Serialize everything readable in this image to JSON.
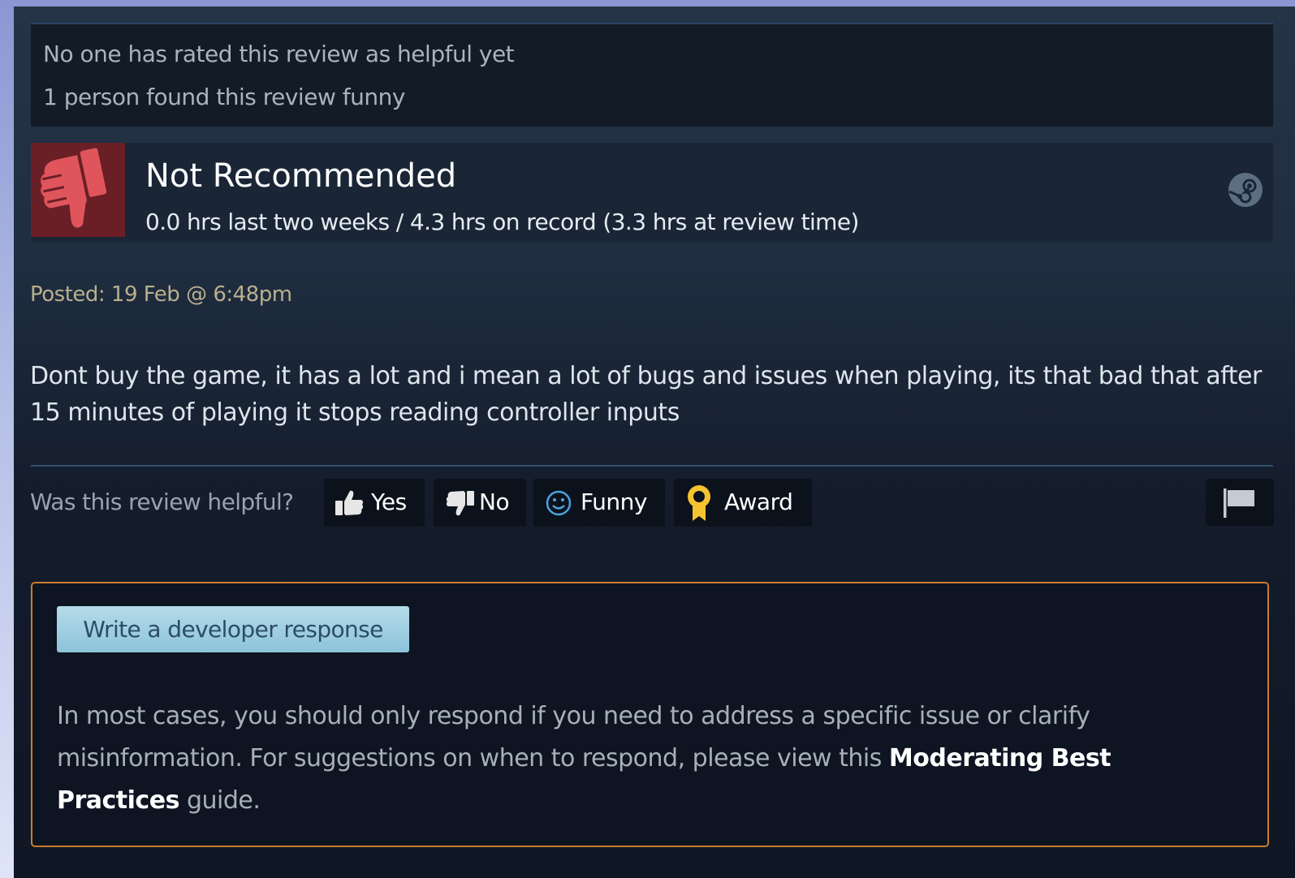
{
  "review": {
    "helpful_summary": "No one has rated this review as helpful yet",
    "funny_summary": "1 person found this review funny",
    "verdict_icon": "thumbs-down-icon",
    "verdict": "Not Recommended",
    "hours": "0.0 hrs last two weeks / 4.3 hrs on record (3.3 hrs at review time)",
    "platform_icon": "steam-icon",
    "posted": "Posted: 19 Feb @ 6:48pm",
    "body": "Dont buy the game, it has a lot and i mean a lot of bugs and issues when playing, its that bad that after 15 minutes of playing it stops reading controller inputs"
  },
  "rating": {
    "question": "Was this review helpful?",
    "yes_label": "Yes",
    "no_label": "No",
    "funny_label": "Funny",
    "award_label": "Award",
    "flag_icon": "flag-icon"
  },
  "developer": {
    "button_label": "Write a developer response",
    "note_prefix": "In most cases, you should only respond if you need to address a specific issue or clarify misinformation. For suggestions on when to respond, please view this ",
    "note_link": "Moderating Best Practices",
    "note_suffix": " guide."
  },
  "colors": {
    "not_recommended_bg": "#6a1f26",
    "thumb_down": "#e0555c",
    "posted_text": "#b9b08c",
    "dev_box_border": "#c77d2c",
    "dev_button_bg": "#9fd0e3",
    "award_gold": "#f4c430",
    "funny_blue": "#4aa3df"
  }
}
